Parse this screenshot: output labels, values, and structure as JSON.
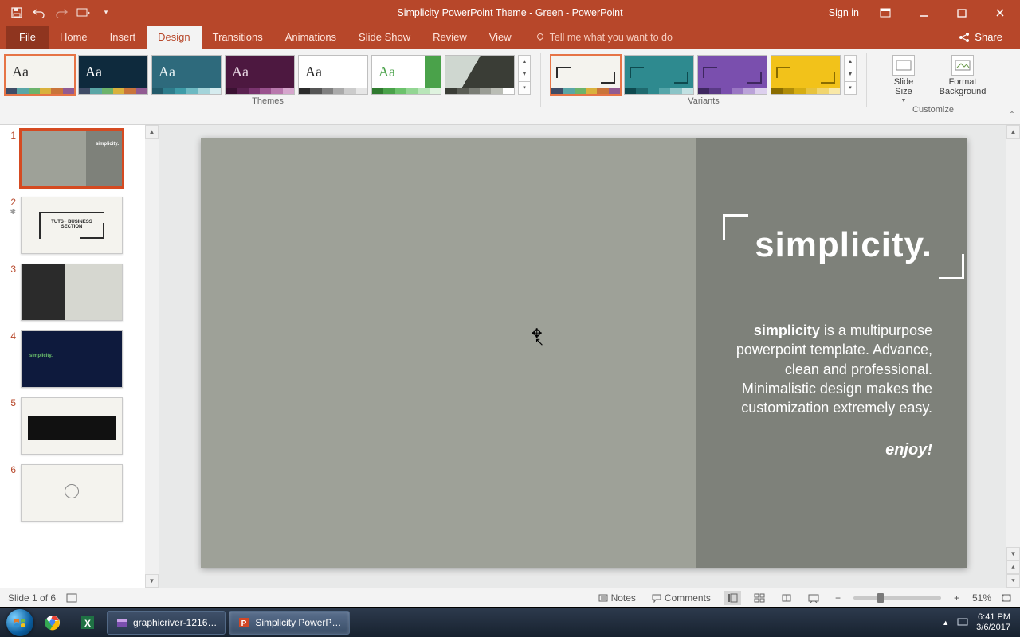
{
  "window": {
    "title": "Simplicity PowerPoint Theme - Green  -  PowerPoint",
    "signin": "Sign in"
  },
  "tabs": {
    "file": "File",
    "items": [
      "Home",
      "Insert",
      "Design",
      "Transitions",
      "Animations",
      "Slide Show",
      "Review",
      "View"
    ],
    "active": "Design",
    "tellme": "Tell me what you want to do",
    "share": "Share"
  },
  "ribbon": {
    "themes_label": "Themes",
    "variants_label": "Variants",
    "customize_label": "Customize",
    "slide_size": "Slide\nSize",
    "format_bg": "Format\nBackground"
  },
  "thumbnails": [
    {
      "num": "1",
      "selected": true
    },
    {
      "num": "2",
      "selected": false,
      "star": true
    },
    {
      "num": "3",
      "selected": false
    },
    {
      "num": "4",
      "selected": false
    },
    {
      "num": "5",
      "selected": false
    },
    {
      "num": "6",
      "selected": false
    }
  ],
  "slide": {
    "title": "simplicity.",
    "desc_bold": "simplicity",
    "desc_rest": " is a multipurpose powerpoint template. Advance, clean and professional. Minimalistic design makes the customization extremely easy.",
    "enjoy": "enjoy!"
  },
  "status": {
    "slide_pos": "Slide 1 of 6",
    "notes": "Notes",
    "comments": "Comments",
    "zoom": "51%"
  },
  "taskbar": {
    "task1": "graphicriver-1216…",
    "task2": "Simplicity PowerP…",
    "time": "6:41 PM",
    "date": "3/6/2017"
  },
  "themes": [
    {
      "bg": "#f4f3ee",
      "fg": "#2b2b2b",
      "strip": [
        "#3f4c66",
        "#5aa6a6",
        "#6cb36b",
        "#d9b13c",
        "#c9743a",
        "#915b92"
      ],
      "selected": true
    },
    {
      "bg": "#0e2a3d",
      "fg": "#ffffff",
      "strip": [
        "#3f4c66",
        "#5aa6a6",
        "#6cb36b",
        "#d9b13c",
        "#c9743a",
        "#915b92"
      ]
    },
    {
      "bg": "#2e6a7c",
      "fg": "#e8f3f5",
      "strip": [
        "#225a6a",
        "#2e7d8c",
        "#3d9ba7",
        "#6cb9c2",
        "#a4d4da",
        "#d6ecef"
      ]
    },
    {
      "bg": "#4d1840",
      "fg": "#e8d7e3",
      "strip": [
        "#3b1232",
        "#5a2150",
        "#7a346f",
        "#9a528e",
        "#b978ad",
        "#d6a6cd"
      ]
    },
    {
      "bg": "#ffffff",
      "fg": "#2b2b2b",
      "strip": [
        "#2b2b2b",
        "#555555",
        "#808080",
        "#aaaaaa",
        "#cccccc",
        "#e6e6e6"
      ]
    },
    {
      "bg": "#ffffff",
      "fg": "#4aa24a",
      "strip": [
        "#2f7a2f",
        "#4aa24a",
        "#6cc26c",
        "#93d693",
        "#b9e6b9",
        "#dff3df"
      ],
      "accent": true
    },
    {
      "bg": "#cfd7d0",
      "fg": "#3a3d36",
      "strip": [
        "#3a3d36",
        "#5a5d55",
        "#7a7d75",
        "#9a9d95",
        "#babdb5",
        "#dadd d5"
      ],
      "image": true
    }
  ],
  "variants": [
    {
      "bg": "#f4f3ee",
      "border": "#2b2b2b",
      "strip": [
        "#3f4c66",
        "#5aa6a6",
        "#6cb36b",
        "#d9b13c",
        "#c9743a",
        "#915b92"
      ],
      "selected": true
    },
    {
      "bg": "#2e8a8f",
      "border": "#0e4a4f",
      "strip": [
        "#0e4a4f",
        "#1f6a6f",
        "#2e8a8f",
        "#55a6aa",
        "#8bc4c7",
        "#c2e1e3"
      ]
    },
    {
      "bg": "#7a4fae",
      "border": "#3e2760",
      "strip": [
        "#3e2760",
        "#5a3a86",
        "#7a4fae",
        "#9a77c4",
        "#bba3d9",
        "#ddd0ee"
      ]
    },
    {
      "bg": "#f2c21a",
      "border": "#8a6c00",
      "strip": [
        "#8a6c00",
        "#b08c08",
        "#d6ad12",
        "#e8c33d",
        "#f1d56f",
        "#f9e8a7"
      ]
    }
  ]
}
